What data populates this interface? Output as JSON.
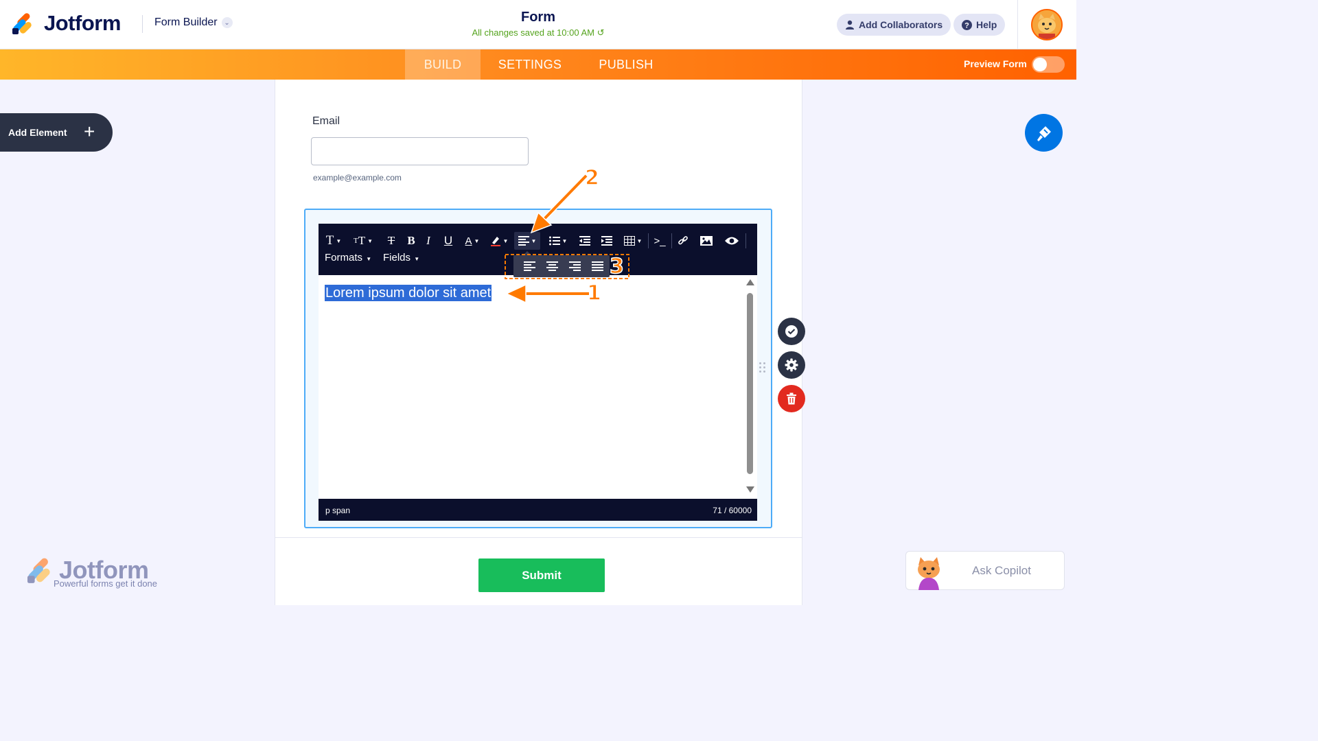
{
  "header": {
    "brand": "Jotform",
    "builder_menu": "Form Builder",
    "form_title": "Form",
    "save_status": "All changes saved at 10:00 AM",
    "add_collaborators": "Add Collaborators",
    "help": "Help"
  },
  "nav": {
    "tabs": [
      "BUILD",
      "SETTINGS",
      "PUBLISH"
    ],
    "active_tab": "BUILD",
    "preview_form_label": "Preview Form",
    "preview_form_enabled": false
  },
  "sidebar": {
    "add_element": "Add Element"
  },
  "form": {
    "email_label": "Email",
    "email_value": "",
    "email_sublabel": "example@example.com",
    "submit_label": "Submit"
  },
  "editor": {
    "toolbar_row2": [
      "Formats",
      "Fields"
    ],
    "content_text": "Lorem ipsum dolor sit amet",
    "status_path": "p  span",
    "char_count": "71 / 60000"
  },
  "annotations": [
    "1",
    "2",
    "3"
  ],
  "watermark": {
    "brand": "Jotform",
    "tagline": "Powerful forms get it done"
  },
  "copilot": {
    "label": "Ask Copilot"
  },
  "colors": {
    "orange_accent": "#ff6100",
    "selection_blue": "#2e6bd7",
    "submit_green": "#18bd5b",
    "save_green": "#54a31d",
    "delete_red": "#e22a1f",
    "dark_toolbar": "#0b0f2c"
  }
}
